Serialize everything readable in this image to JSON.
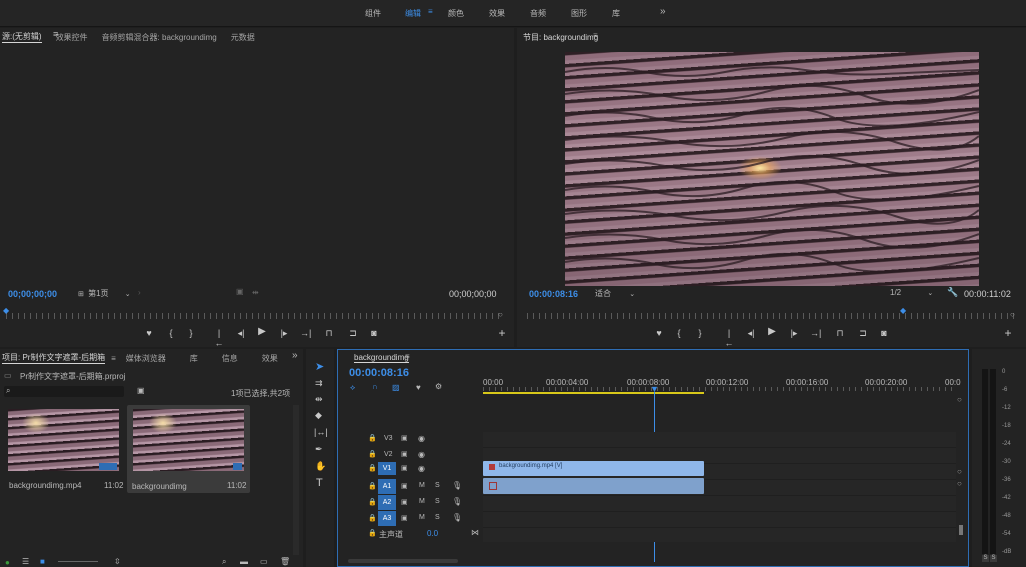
{
  "workspaces": {
    "items": [
      "组件",
      "编辑",
      "颜色",
      "效果",
      "音频",
      "图形",
      "库"
    ],
    "active": "编辑",
    "more": "»"
  },
  "source": {
    "tabs": [
      "源:(无剪辑)",
      "效果控件",
      "音频剪辑混合器: backgroundimg",
      "元数据"
    ],
    "timecode_left": "00;00;00;00",
    "page_select": "第1页",
    "timecode_right": "00;00;00;00"
  },
  "program": {
    "title": "节目: backgroundimg",
    "timecode": "00:00:08:16",
    "fit": "适合",
    "resolution": "1/2",
    "duration": "00:00:11:02"
  },
  "project": {
    "tabs": [
      "项目: Pr制作文字遮罩-后期箱",
      "媒体浏览器",
      "库",
      "信息",
      "效果"
    ],
    "file": "Pr制作文字遮罩-后期箱.prproj",
    "selection": "1项已选择,共2项",
    "items": [
      {
        "name": "backgroundimg.mp4",
        "duration": "11:02"
      },
      {
        "name": "backgroundimg",
        "duration": "11:02"
      }
    ]
  },
  "timeline": {
    "tab": "backgroundimg",
    "timecode": "00:00:08:16",
    "ruler": [
      "00:00",
      "00:00:04:00",
      "00:00:08:00",
      "00:00:12:00",
      "00:00:16:00",
      "00:00:20:00",
      "00:0"
    ],
    "video_tracks": [
      "V3",
      "V2",
      "V1"
    ],
    "audio_tracks": [
      "A1",
      "A2",
      "A3"
    ],
    "master_label": "主声道",
    "master_value": "0.0",
    "clip_label": "backgroundimg.mp4 [V]"
  },
  "meters": {
    "scale": [
      "0",
      "-6",
      "-12",
      "-18",
      "-24",
      "-30",
      "-36",
      "-42",
      "-48",
      "-54",
      "-dB"
    ],
    "solo": [
      "S",
      "S"
    ]
  },
  "colors": {
    "accent": "#3d8ee8",
    "clip": "#8fb7ea",
    "workarea": "#d8c81a"
  }
}
